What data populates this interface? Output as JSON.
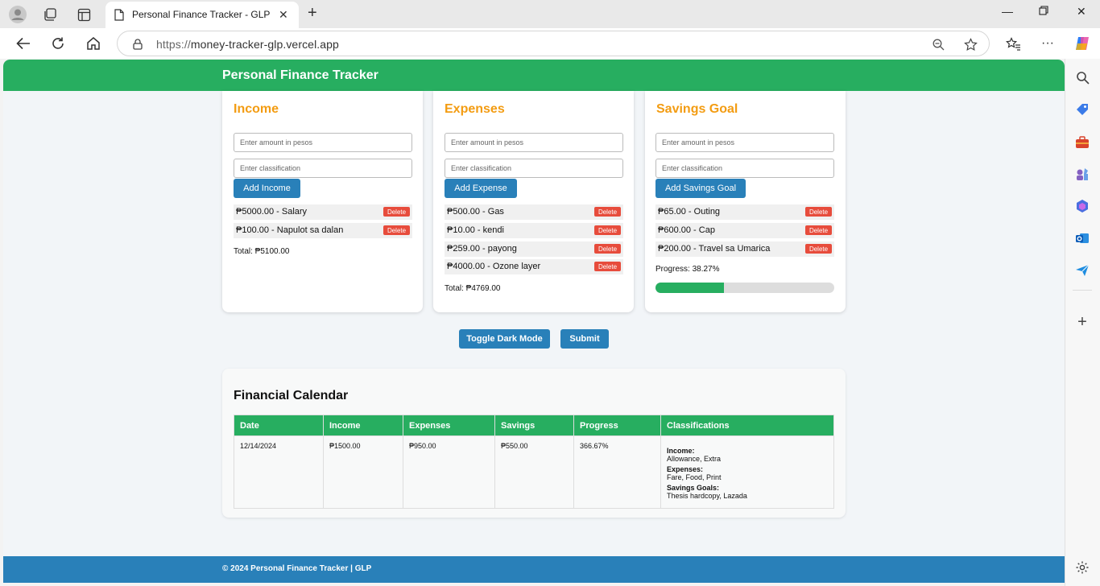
{
  "browser": {
    "tab_title": "Personal Finance Tracker - GLP",
    "url_scheme": "https://",
    "url_host": "money-tracker-glp.vercel.app"
  },
  "app": {
    "title": "Personal Finance Tracker",
    "footer": "© 2024 Personal Finance Tracker | GLP",
    "accent": "#27ae60",
    "primary_button": "#2980b9",
    "heading_color": "#f39c12",
    "delete_color": "#e74c3c"
  },
  "income": {
    "title": "Income",
    "amount_placeholder": "Enter amount in pesos",
    "class_placeholder": "Enter classification",
    "button": "Add Income",
    "entries": [
      "₱5000.00 - Salary",
      "₱100.00 - Napulot sa dalan"
    ],
    "total": "Total: ₱5100.00"
  },
  "expenses": {
    "title": "Expenses",
    "amount_placeholder": "Enter amount in pesos",
    "class_placeholder": "Enter classification",
    "button": "Add Expense",
    "entries": [
      "₱500.00 - Gas",
      "₱10.00 - kendi",
      "₱259.00 - payong",
      "₱4000.00 - Ozone layer"
    ],
    "total": "Total: ₱4769.00"
  },
  "savings": {
    "title": "Savings Goal",
    "amount_placeholder": "Enter amount in pesos",
    "class_placeholder": "Enter classification",
    "button": "Add Savings Goal",
    "entries": [
      "₱65.00 - Outing",
      "₱600.00 - Cap",
      "₱200.00 - Travel sa Umarica"
    ],
    "progress_label": "Progress: 38.27%",
    "progress_fraction": 0.3827
  },
  "delete_label": "Delete",
  "actions": {
    "toggle": "Toggle Dark Mode",
    "submit": "Submit"
  },
  "calendar": {
    "title": "Financial Calendar",
    "headers": [
      "Date",
      "Income",
      "Expenses",
      "Savings",
      "Progress",
      "Classifications"
    ],
    "row": {
      "date": "12/14/2024",
      "income": "₱1500.00",
      "expenses": "₱950.00",
      "savings": "₱550.00",
      "progress": "366.67%",
      "income_h": "Income:",
      "income_cls": "Allowance, Extra",
      "expenses_h": "Expenses:",
      "expenses_cls": "Fare, Food, Print",
      "savings_h": "Savings Goals:",
      "savings_cls": "Thesis hardcopy, Lazada"
    }
  }
}
